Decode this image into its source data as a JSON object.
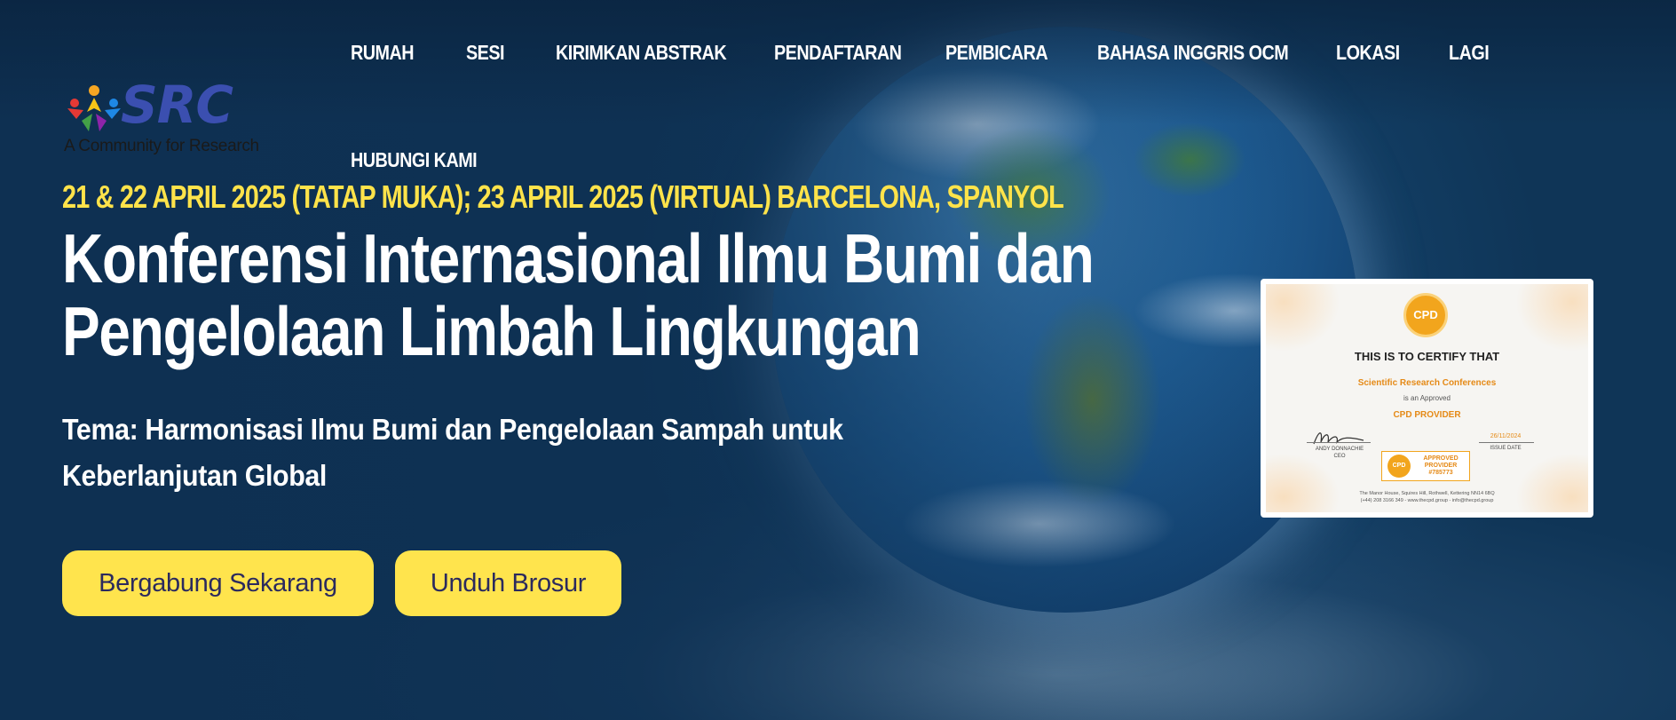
{
  "brand": {
    "logo_text": "SRC",
    "tagline": "A Community for Research"
  },
  "nav": {
    "items": [
      {
        "label": "RUMAH"
      },
      {
        "label": "SESI"
      },
      {
        "label": "KIRIMKAN ABSTRAK"
      },
      {
        "label": "PENDAFTARAN"
      },
      {
        "label": "PEMBICARA"
      },
      {
        "label": "BAHASA INGGRIS OCM"
      },
      {
        "label": "LOKASI"
      },
      {
        "label": "LAGI"
      },
      {
        "label": "HUBUNGI KAMI"
      }
    ]
  },
  "hero": {
    "dates": "21 & 22 APRIL 2025 (TATAP MUKA); 23 APRIL 2025 (VIRTUAL) BARCELONA, SPANYOL",
    "title_line1": "Konferensi Internasional Ilmu Bumi dan",
    "title_line2": "Pengelolaan Limbah Lingkungan",
    "theme_line1": "Tema: Harmonisasi Ilmu Bumi dan Pengelolaan Sampah untuk",
    "theme_line2": "Keberlanjutan Global",
    "join_label": "Bergabung Sekarang",
    "brochure_label": "Unduh Brosur"
  },
  "certificate": {
    "seal": "CPD",
    "heading": "THIS IS TO CERTIFY THAT",
    "org": "Scientific Research Conferences",
    "approved": "is an Approved",
    "provider": "CPD PROVIDER",
    "signer_name": "ANDY DONNACHIE",
    "signer_role": "CEO",
    "issue_date": "26/11/2024",
    "issue_label": "ISSUE DATE",
    "badge_seal": "CPD",
    "badge_line1": "APPROVED",
    "badge_line2": "PROVIDER",
    "badge_number": "#785773",
    "footer_line1": "The Manor House, Squires Hill, Rothwell, Kettering NN14 6BQ",
    "footer_line2": "(+44) 208 3166 349 - www.thecpd.group - info@thecpd.group"
  },
  "colors": {
    "accent_yellow": "#ffe44d",
    "background_navy": "#0f3557",
    "button_text": "#2b2a5e",
    "cert_orange": "#e58a17"
  },
  "icons": {
    "logo_mark": "people-star-logo-icon",
    "background": "earth-globe-image"
  }
}
